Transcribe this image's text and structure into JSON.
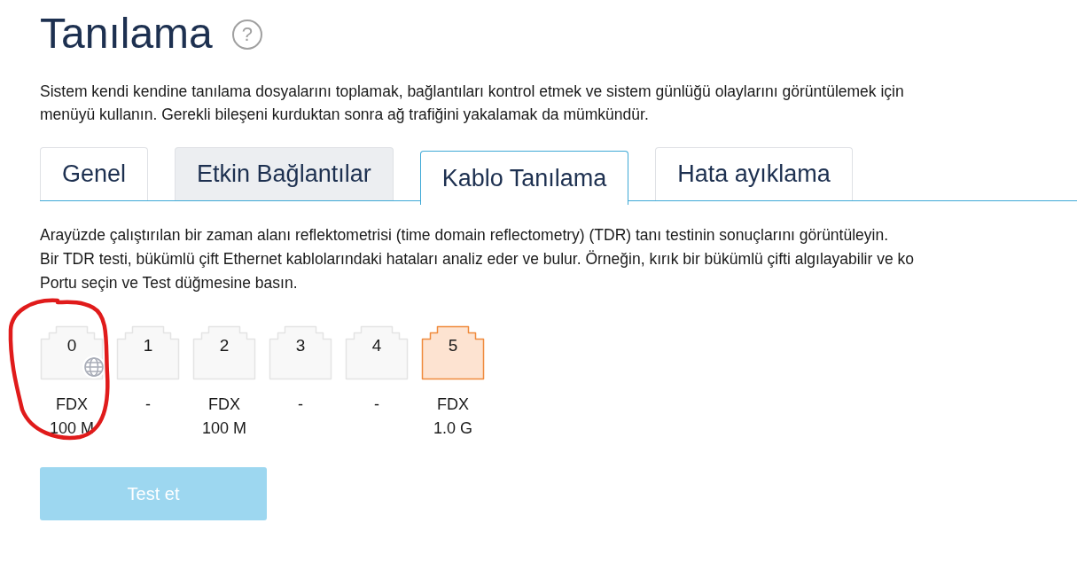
{
  "page": {
    "title": "Tanılama",
    "help": "?",
    "description_lines": [
      "Sistem kendi kendine tanılama dosyalarını toplamak, bağlantıları kontrol etmek ve sistem günlüğü olaylarını görüntülemek için",
      "menüyü kullanın. Gerekli bileşeni kurduktan sonra ağ trafiğini yakalamak da mümkündür."
    ]
  },
  "tabs": [
    {
      "label": "Genel",
      "selected": false,
      "shaded": false
    },
    {
      "label": "Etkin Bağlantılar",
      "selected": false,
      "shaded": true
    },
    {
      "label": "Kablo Tanılama",
      "selected": true,
      "shaded": false
    },
    {
      "label": "Hata ayıklama",
      "selected": false,
      "shaded": false
    }
  ],
  "intro_lines": [
    "Arayüzde çalıştırılan bir zaman alanı reflektometrisi (time domain reflectometry) (TDR) tanı testinin sonuçlarını görüntüleyin.",
    "Bir TDR testi, bükümlü çift Ethernet kablolarındaki hataları analiz eder ve bulur. Örneğin, kırık bir bükümlü çifti algılayabilir ve ko",
    "Portu seçin ve Test düğmesine basın."
  ],
  "ports": [
    {
      "number": "0",
      "selected": false,
      "uplink": true,
      "circled": true,
      "status": [
        "FDX",
        "100 M"
      ]
    },
    {
      "number": "1",
      "selected": false,
      "uplink": false,
      "circled": false,
      "status": [
        "-"
      ]
    },
    {
      "number": "2",
      "selected": false,
      "uplink": false,
      "circled": false,
      "status": [
        "FDX",
        "100 M"
      ]
    },
    {
      "number": "3",
      "selected": false,
      "uplink": false,
      "circled": false,
      "status": [
        "-"
      ]
    },
    {
      "number": "4",
      "selected": false,
      "uplink": false,
      "circled": false,
      "status": [
        "-"
      ]
    },
    {
      "number": "5",
      "selected": true,
      "uplink": false,
      "circled": false,
      "status": [
        "FDX",
        "1.0 G"
      ]
    }
  ],
  "test_button": {
    "label": "Test et",
    "disabled": true
  }
}
